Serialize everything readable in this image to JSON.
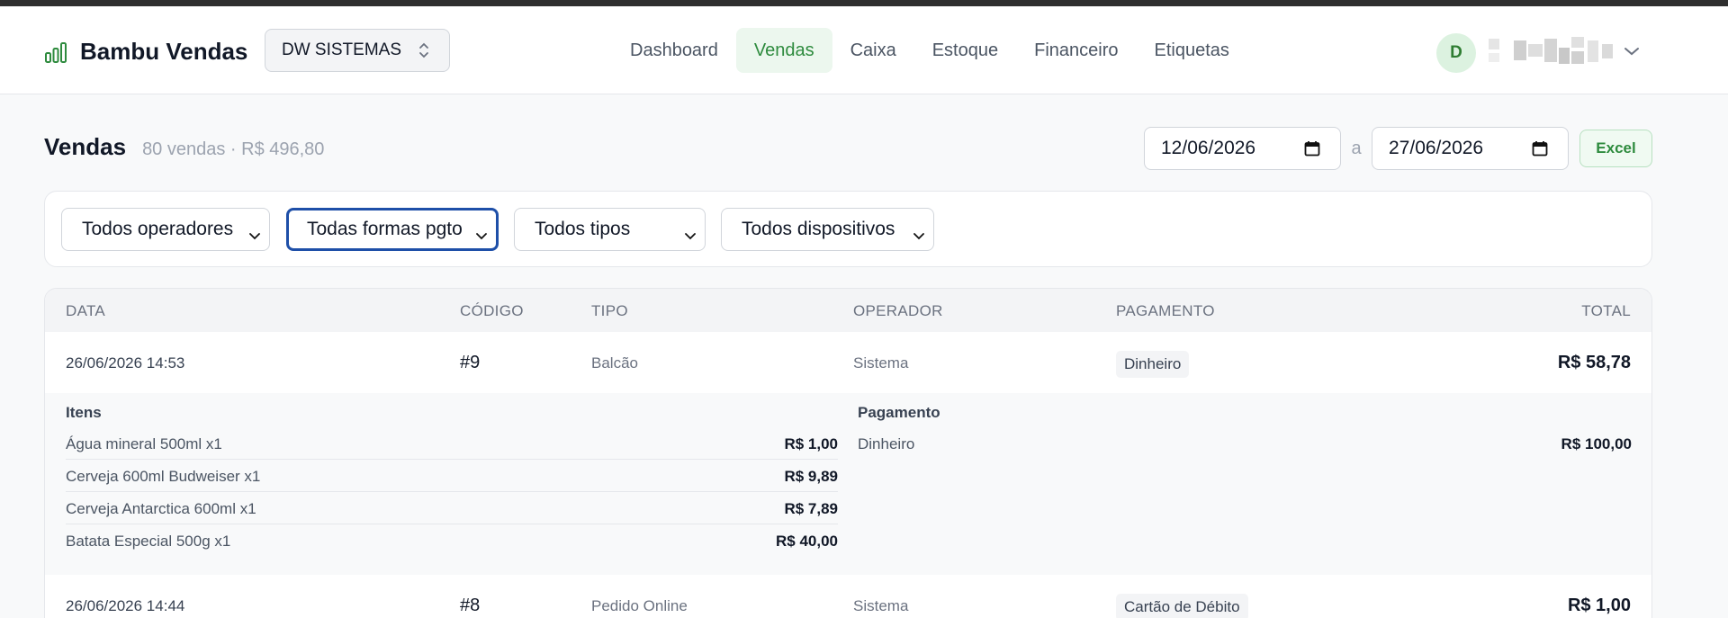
{
  "brand": {
    "name": "Bambu Vendas",
    "accent": "#2e8b3e"
  },
  "company_selector": {
    "value": "DW SISTEMAS"
  },
  "nav": [
    {
      "label": "Dashboard",
      "active": false
    },
    {
      "label": "Vendas",
      "active": true
    },
    {
      "label": "Caixa",
      "active": false
    },
    {
      "label": "Estoque",
      "active": false
    },
    {
      "label": "Financeiro",
      "active": false
    },
    {
      "label": "Etiquetas",
      "active": false
    }
  ],
  "user": {
    "initial": "D"
  },
  "page": {
    "title": "Vendas",
    "subtitle": "80 vendas · R$ 496,80"
  },
  "date_range": {
    "from": "12/06/2026",
    "separator": "a",
    "to": "27/06/2026"
  },
  "export": {
    "label": "Excel"
  },
  "filters": {
    "operators": "Todos operadores",
    "payment_methods": "Todas formas pgto",
    "types": "Todos tipos",
    "devices": "Todos dispositivos"
  },
  "table": {
    "columns": [
      "DATA",
      "CÓDIGO",
      "TIPO",
      "OPERADOR",
      "PAGAMENTO",
      "TOTAL"
    ],
    "rows": [
      {
        "date": "26/06/2026 14:53",
        "code": "#9",
        "type": "Balcão",
        "operator": "Sistema",
        "payment": "Dinheiro",
        "total": "R$ 58,78",
        "details": {
          "items_title": "Itens",
          "items": [
            {
              "name": "Água mineral 500ml x1",
              "value": "R$ 1,00"
            },
            {
              "name": "Cerveja 600ml Budweiser x1",
              "value": "R$ 9,89"
            },
            {
              "name": "Cerveja Antarctica 600ml x1",
              "value": "R$ 7,89"
            },
            {
              "name": "Batata Especial 500g x1",
              "value": "R$ 40,00"
            }
          ],
          "payment_title": "Pagamento",
          "payments": [
            {
              "method": "Dinheiro",
              "value": "R$ 100,00"
            }
          ]
        }
      },
      {
        "date": "26/06/2026 14:44",
        "code": "#8",
        "type": "Pedido Online",
        "operator": "Sistema",
        "payment": "Cartão de Débito",
        "total": "R$ 1,00"
      }
    ]
  }
}
